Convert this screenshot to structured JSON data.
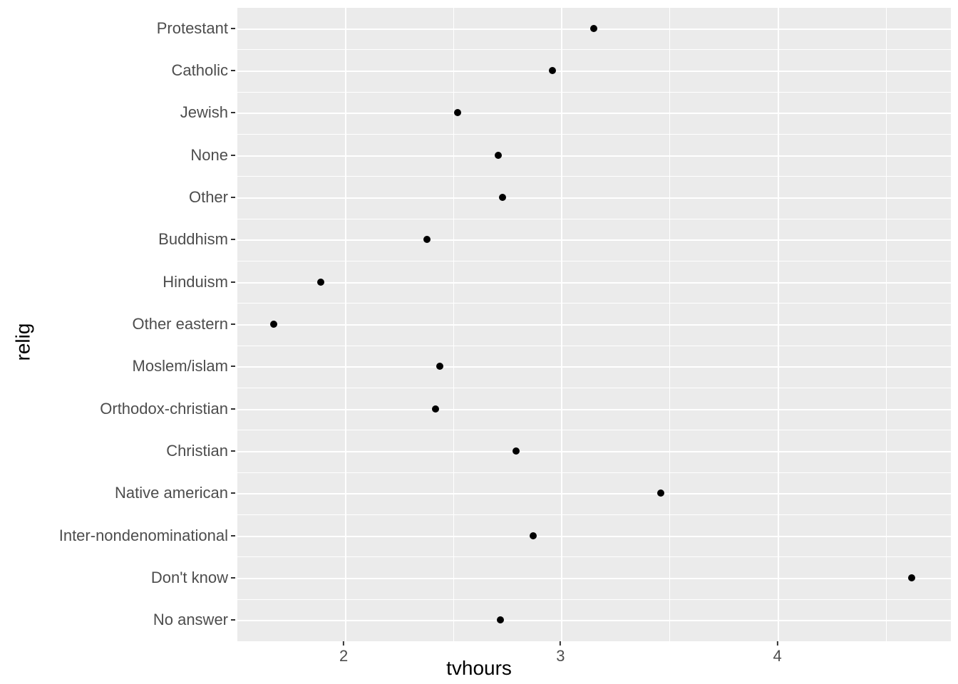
{
  "chart_data": {
    "type": "scatter",
    "xlabel": "tvhours",
    "ylabel": "relig",
    "xlim": [
      1.5,
      4.8
    ],
    "x_ticks": [
      2,
      3,
      4
    ],
    "x_minor_ticks": [
      1.5,
      2.5,
      3.5,
      4.5
    ],
    "categories": [
      "Protestant",
      "Catholic",
      "Jewish",
      "None",
      "Other",
      "Buddhism",
      "Hinduism",
      "Other eastern",
      "Moslem/islam",
      "Orthodox-christian",
      "Christian",
      "Native american",
      "Inter-nondenominational",
      "Don't know",
      "No answer"
    ],
    "values": [
      3.15,
      2.96,
      2.52,
      2.71,
      2.73,
      2.38,
      1.89,
      1.67,
      2.44,
      2.42,
      2.79,
      3.46,
      2.87,
      4.62,
      2.72
    ]
  }
}
